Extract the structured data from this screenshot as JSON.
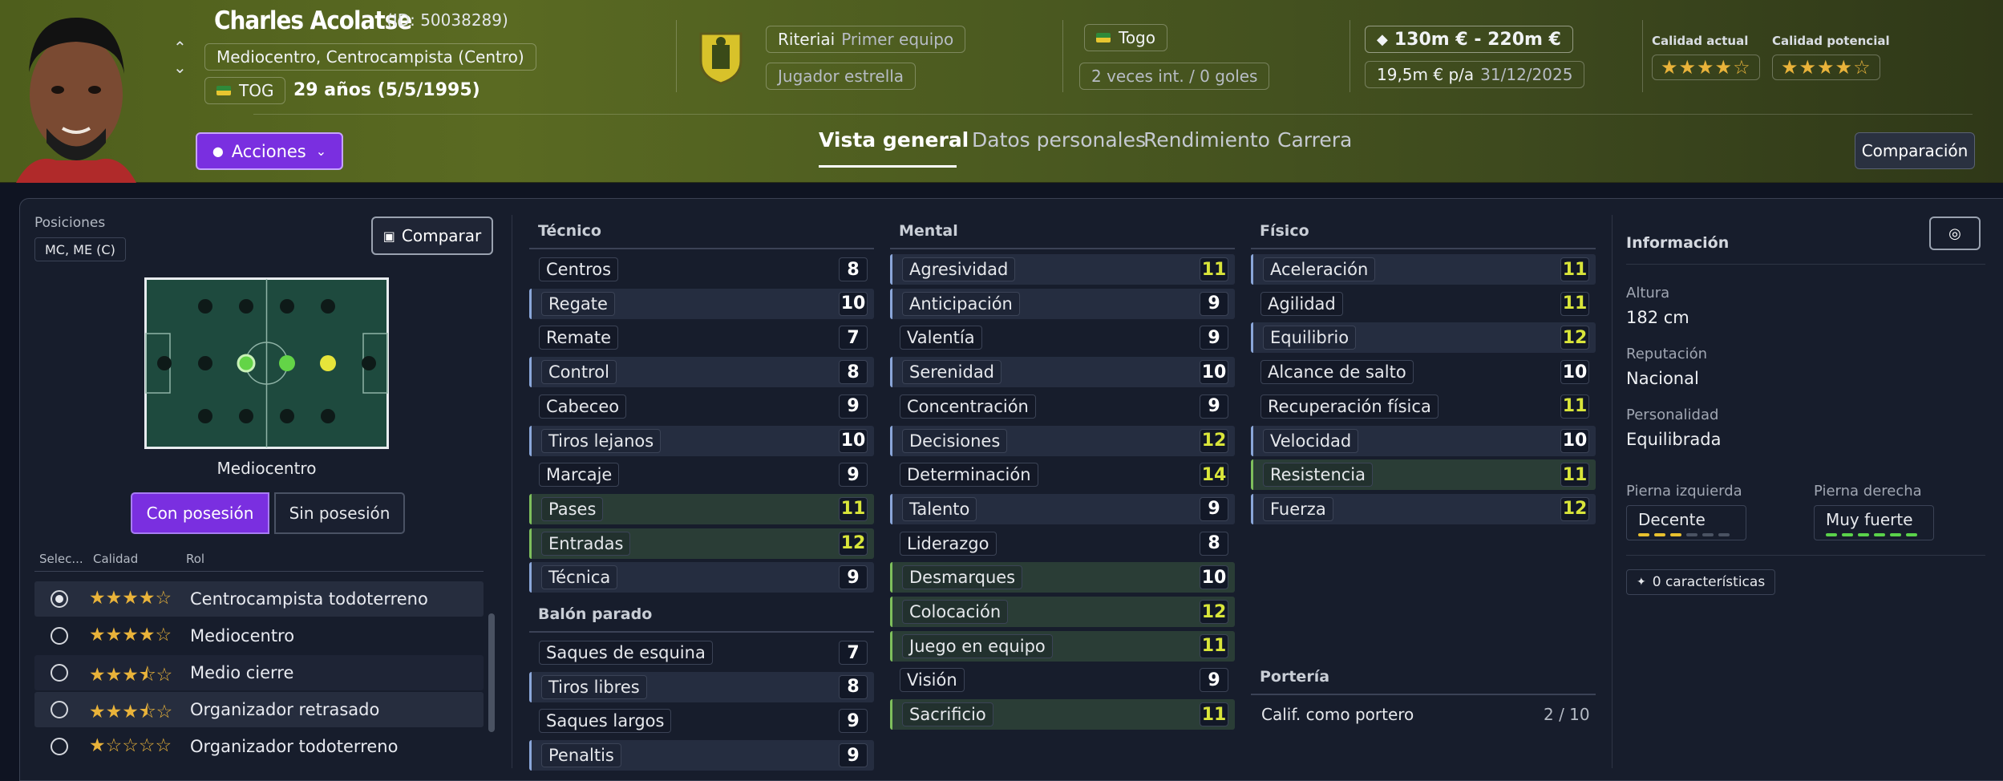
{
  "player": {
    "name": "Charles Acolatse",
    "id_text": "(ID: 50038289)",
    "positions_text": "Mediocentro, Centrocampista (Centro)",
    "nation_short": "TOG",
    "age_text": "29 años (5/5/1995)"
  },
  "actions_label": "Acciones",
  "club": {
    "label": "Riteriai",
    "team": "Primer equipo",
    "role": "Jugador estrella"
  },
  "nation": {
    "name": "Togo",
    "caps": "2 veces int. / 0 goles"
  },
  "value": {
    "range": "130m € - 220m €",
    "wage": "19,5m € p/a",
    "expiry": "31/12/2025"
  },
  "ability": {
    "current_label": "Calidad actual",
    "current_stars": "★★★★☆",
    "potential_label": "Calidad potencial",
    "potential_stars": "★★★★☆"
  },
  "tabs": [
    "Vista general",
    "Datos personales",
    "Rendimiento",
    "Carrera"
  ],
  "compare_button": "Comparación",
  "left": {
    "positions_label": "Posiciones",
    "positions_value": "MC, ME (C)",
    "compare_label": "Comparar",
    "pitch_label": "Mediocentro",
    "toggle_on": "Con posesión",
    "toggle_off": "Sin posesión",
    "col_select": "Selec...",
    "col_quality": "Calidad",
    "col_role": "Rol",
    "roles": [
      {
        "stars": "★★★★☆",
        "name": "Centrocampista todoterreno"
      },
      {
        "stars": "★★★★☆",
        "name": "Mediocentro"
      },
      {
        "stars": "★★★⯪☆",
        "name": "Medio cierre"
      },
      {
        "stars": "★★★⯪☆",
        "name": "Organizador retrasado"
      },
      {
        "stars": "★☆☆☆☆",
        "name": "Organizador todoterreno"
      }
    ]
  },
  "attributes": {
    "tecnico_title": "Técnico",
    "tecnico": [
      {
        "name": "Centros",
        "value": "8"
      },
      {
        "name": "Regate",
        "value": "10"
      },
      {
        "name": "Remate",
        "value": "7"
      },
      {
        "name": "Control",
        "value": "8"
      },
      {
        "name": "Cabeceo",
        "value": "9"
      },
      {
        "name": "Tiros lejanos",
        "value": "10"
      },
      {
        "name": "Marcaje",
        "value": "9"
      },
      {
        "name": "Pases",
        "value": "11"
      },
      {
        "name": "Entradas",
        "value": "12"
      },
      {
        "name": "Técnica",
        "value": "9"
      }
    ],
    "balon_title": "Balón parado",
    "balon": [
      {
        "name": "Saques de esquina",
        "value": "7"
      },
      {
        "name": "Tiros libres",
        "value": "8"
      },
      {
        "name": "Saques largos",
        "value": "9"
      },
      {
        "name": "Penaltis",
        "value": "9"
      }
    ],
    "mental_title": "Mental",
    "mental": [
      {
        "name": "Agresividad",
        "value": "11"
      },
      {
        "name": "Anticipación",
        "value": "9"
      },
      {
        "name": "Valentía",
        "value": "9"
      },
      {
        "name": "Serenidad",
        "value": "10"
      },
      {
        "name": "Concentración",
        "value": "9"
      },
      {
        "name": "Decisiones",
        "value": "12"
      },
      {
        "name": "Determinación",
        "value": "14"
      },
      {
        "name": "Talento",
        "value": "9"
      },
      {
        "name": "Liderazgo",
        "value": "8"
      },
      {
        "name": "Desmarques",
        "value": "10"
      },
      {
        "name": "Colocación",
        "value": "12"
      },
      {
        "name": "Juego en equipo",
        "value": "11"
      },
      {
        "name": "Visión",
        "value": "9"
      },
      {
        "name": "Sacrificio",
        "value": "11"
      }
    ],
    "fisico_title": "Físico",
    "fisico": [
      {
        "name": "Aceleración",
        "value": "11"
      },
      {
        "name": "Agilidad",
        "value": "11"
      },
      {
        "name": "Equilibrio",
        "value": "12"
      },
      {
        "name": "Alcance de salto",
        "value": "10"
      },
      {
        "name": "Recuperación física",
        "value": "11"
      },
      {
        "name": "Velocidad",
        "value": "10"
      },
      {
        "name": "Resistencia",
        "value": "11"
      },
      {
        "name": "Fuerza",
        "value": "12"
      }
    ],
    "porteria_title": "Portería",
    "porteria_label": "Calif. como portero",
    "porteria_value": "2 / 10"
  },
  "info": {
    "title": "Información",
    "height_label": "Altura",
    "height_value": "182 cm",
    "reputation_label": "Reputación",
    "reputation_value": "Nacional",
    "personality_label": "Personalidad",
    "personality_value": "Equilibrada",
    "left_foot_label": "Pierna izquierda",
    "left_foot_value": "Decente",
    "left_foot_level": 0.5,
    "right_foot_label": "Pierna derecha",
    "right_foot_value": "Muy fuerte",
    "right_foot_level": 1.0,
    "traits_label": "0 características"
  },
  "colors": {
    "accent_purple": "#7a2fe0",
    "highlight_value": "#d9e53a",
    "star_gold": "#e9b33a"
  }
}
